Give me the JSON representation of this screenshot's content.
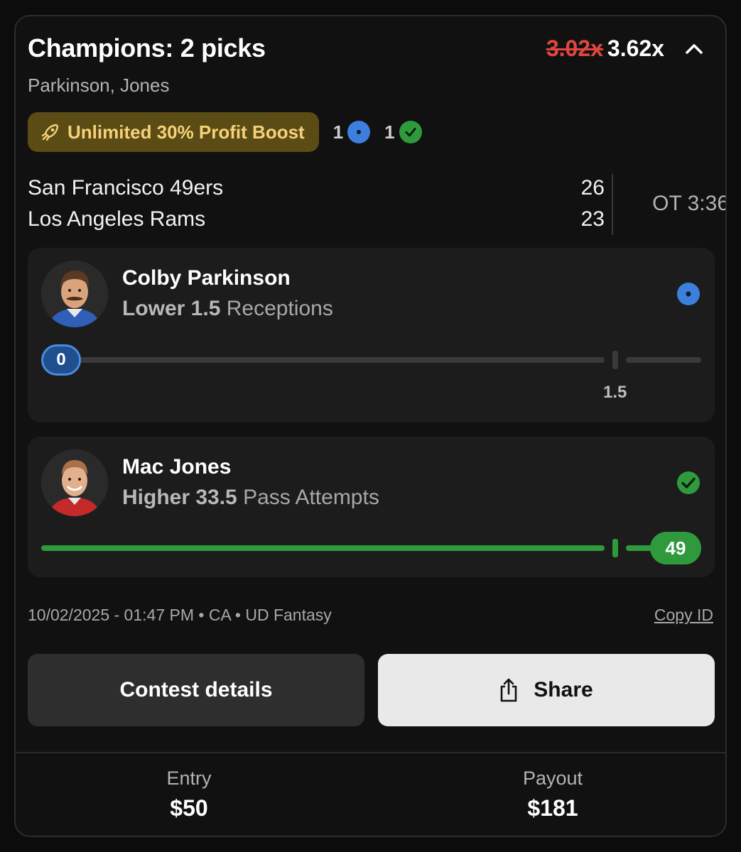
{
  "header": {
    "title": "Champions: 2 picks",
    "multiplier_old": "3.02x",
    "multiplier_new": "3.62x",
    "collapse_icon": "chevron-up-icon"
  },
  "subtitle": "Parkinson, Jones",
  "boost": {
    "label": "Unlimited 30% Profit Boost",
    "icon": "rocket-icon",
    "pending_count": "1",
    "won_count": "1"
  },
  "game": {
    "team1": "San Francisco 49ers",
    "score1": "26",
    "team2": "Los Angeles Rams",
    "score2": "23",
    "clock": "OT 3:36"
  },
  "picks": [
    {
      "player": "Colby Parkinson",
      "direction": "Lower 1.5",
      "stat": "Receptions",
      "line_value": "1.5",
      "current_value": "0",
      "progress_fraction": 0,
      "status": "pending",
      "status_color": "#3d7fdc"
    },
    {
      "player": "Mac Jones",
      "direction": "Higher 33.5",
      "stat": "Pass Attempts",
      "line_value": "33.5",
      "current_value": "49",
      "progress_fraction": 1,
      "status": "won",
      "status_color": "#2f9a3c"
    }
  ],
  "meta": {
    "info": "10/02/2025 - 01:47 PM • CA • UD Fantasy",
    "copy_id": "Copy ID"
  },
  "buttons": {
    "contest_details": "Contest details",
    "share": "Share",
    "share_icon": "share-icon"
  },
  "footer": {
    "entry_label": "Entry",
    "entry_value": "$50",
    "payout_label": "Payout",
    "payout_value": "$181"
  },
  "colors": {
    "boost_bg": "#5b4b14",
    "boost_text": "#f4d27a",
    "strike_red": "#e0463e",
    "green": "#2f9a3c",
    "blue": "#3d7fdc"
  }
}
